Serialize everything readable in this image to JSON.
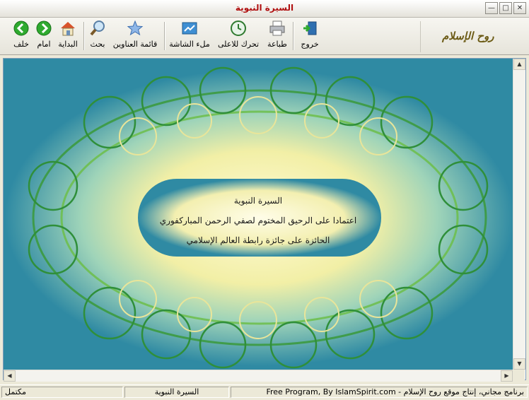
{
  "window": {
    "title": "السيرة النبوية"
  },
  "toolbar": {
    "back_label": "خلف",
    "forward_label": "امام",
    "home_label": "البداية",
    "search_label": "بحث",
    "toc_label": "قائمة العناوين",
    "fullscreen_label": "ملء الشاشة",
    "top_label": "تحرك للاعلى",
    "print_label": "طباعة",
    "exit_label": "خروج"
  },
  "logo": {
    "text": "روح الإسلام"
  },
  "content": {
    "title": "السيرة النبوية",
    "subtitle": "اعتمادا على الرحيق المختوم لصفي الرحمن المباركفوري",
    "award": "الحائزة على جائزة رابطة العالم الإسلامي"
  },
  "status": {
    "state": "مكتمل",
    "page": "السيرة النبوية",
    "credits": "Free Program, By IslamSpirit.com - برنامج مجاني، إنتاج موقع روح الإسلام"
  },
  "colors": {
    "accent": "#2f8aa3",
    "ornament": "#3a9a3a",
    "title_red": "#b01010"
  }
}
